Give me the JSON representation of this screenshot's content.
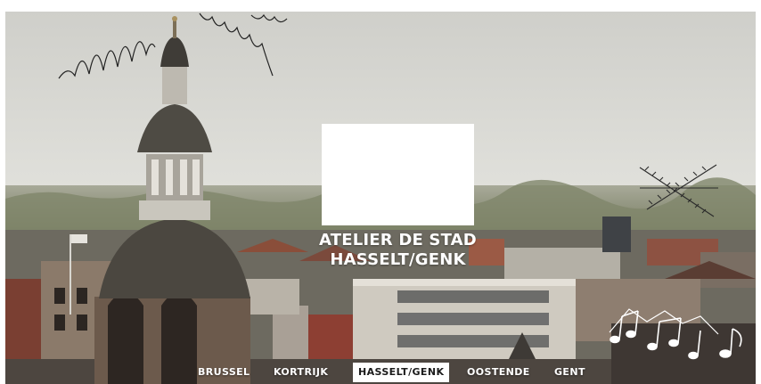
{
  "hero": {
    "title_line1": "ATELIER DE STAD",
    "title_line2": "HASSELT/GENK"
  },
  "nav": {
    "items": [
      {
        "label": "BRUSSEL",
        "active": false
      },
      {
        "label": "KORTRIJK",
        "active": false
      },
      {
        "label": "HASSELT/GENK",
        "active": true
      },
      {
        "label": "OOSTENDE",
        "active": false
      },
      {
        "label": "GENT",
        "active": false
      }
    ]
  },
  "colors": {
    "sky": "#dcdcd6",
    "tower_stone": "#5d564c",
    "text": "#ffffff",
    "active_bg": "#ffffff",
    "active_text": "#1b1b1b"
  },
  "icons": [
    "scribble-doodle-icon",
    "antenna-doodle-icon",
    "music-notes-doodle-icon"
  ]
}
